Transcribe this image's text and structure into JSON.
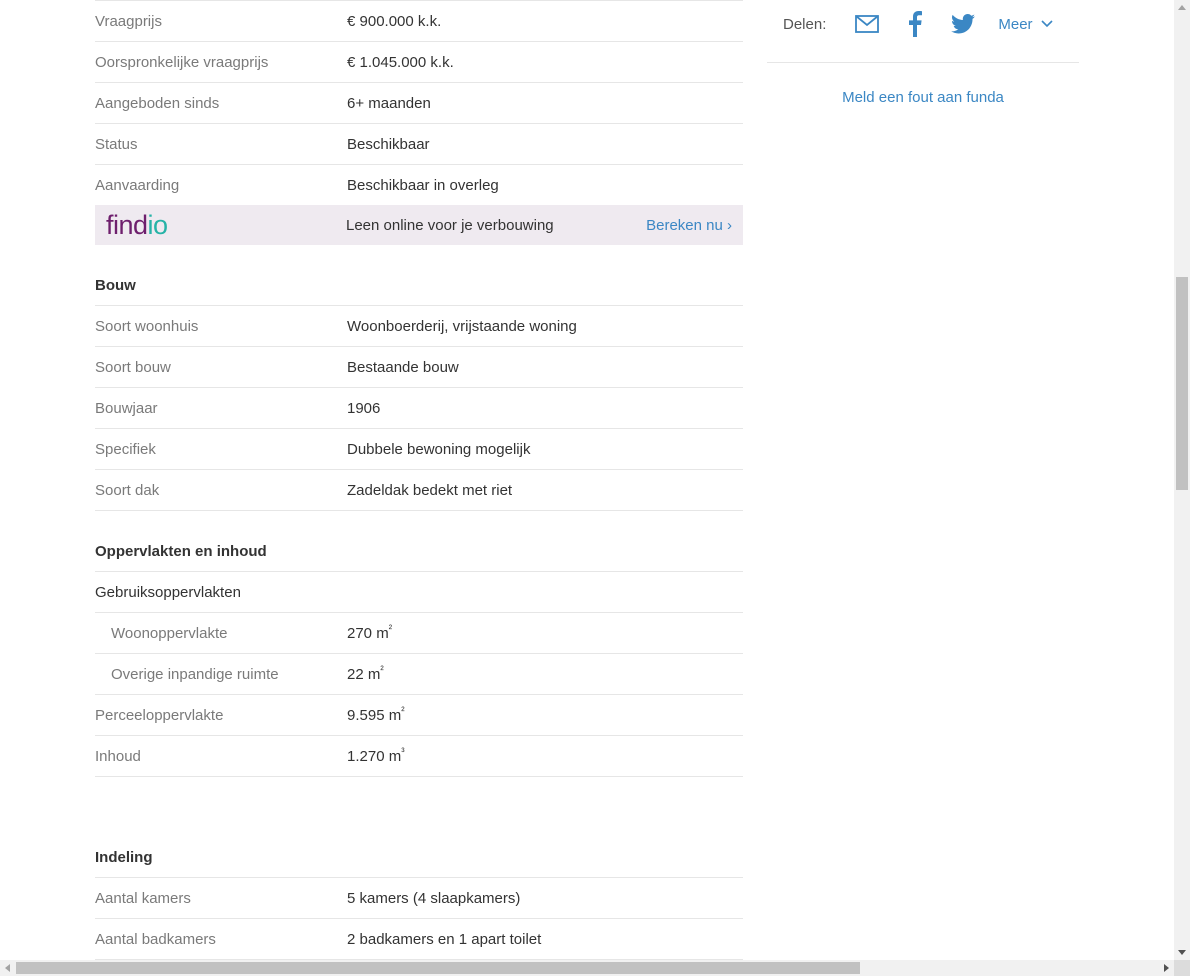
{
  "overdracht": [
    {
      "label": "Vraagprijs",
      "value": "€ 900.000 k.k."
    },
    {
      "label": "Oorspronkelijke vraagprijs",
      "value": "€ 1.045.000 k.k."
    },
    {
      "label": "Aangeboden sinds",
      "value": "6+ maanden"
    },
    {
      "label": "Status",
      "value": "Beschikbaar"
    },
    {
      "label": "Aanvaarding",
      "value": "Beschikbaar in overleg"
    }
  ],
  "promo": {
    "logo_text_a": "find",
    "logo_text_b": "io",
    "text": "Leen online voor je verbouwing",
    "cta": "Bereken nu ›"
  },
  "bouw": {
    "heading": "Bouw",
    "rows": [
      {
        "label": "Soort woonhuis",
        "value": "Woonboerderij, vrijstaande woning"
      },
      {
        "label": "Soort bouw",
        "value": "Bestaande bouw"
      },
      {
        "label": "Bouwjaar",
        "value": "1906"
      },
      {
        "label": "Specifiek",
        "value": "Dubbele bewoning mogelijk"
      },
      {
        "label": "Soort dak",
        "value": "Zadeldak bedekt met riet"
      }
    ]
  },
  "oppervlakten": {
    "heading": "Oppervlakten en inhoud",
    "subheading": "Gebruiksoppervlakten",
    "woon": {
      "label": "Woonoppervlakte",
      "value": "270 m",
      "unit": "²"
    },
    "overig": {
      "label": "Overige inpandige ruimte",
      "value": "22 m",
      "unit": "²"
    },
    "perceel": {
      "label": "Perceeloppervlakte",
      "value": "9.595 m",
      "unit": "²"
    },
    "inhoud": {
      "label": "Inhoud",
      "value": "1.270 m",
      "unit": "³"
    }
  },
  "indeling": {
    "heading": "Indeling",
    "rows": [
      {
        "label": "Aantal kamers",
        "value": "5 kamers (4 slaapkamers)"
      },
      {
        "label": "Aantal badkamers",
        "value": "2 badkamers en 1 apart toilet"
      }
    ]
  },
  "share": {
    "label": "Delen:",
    "more": "Meer",
    "icons": [
      "mail-icon",
      "facebook-icon",
      "twitter-icon",
      "chevron-down-icon"
    ]
  },
  "report": "Meld een fout aan funda",
  "colors": {
    "link": "#3b87c4",
    "promo_bg": "#efeaf0",
    "findio_purple": "#6e1f6d",
    "findio_teal": "#26b3a7"
  }
}
